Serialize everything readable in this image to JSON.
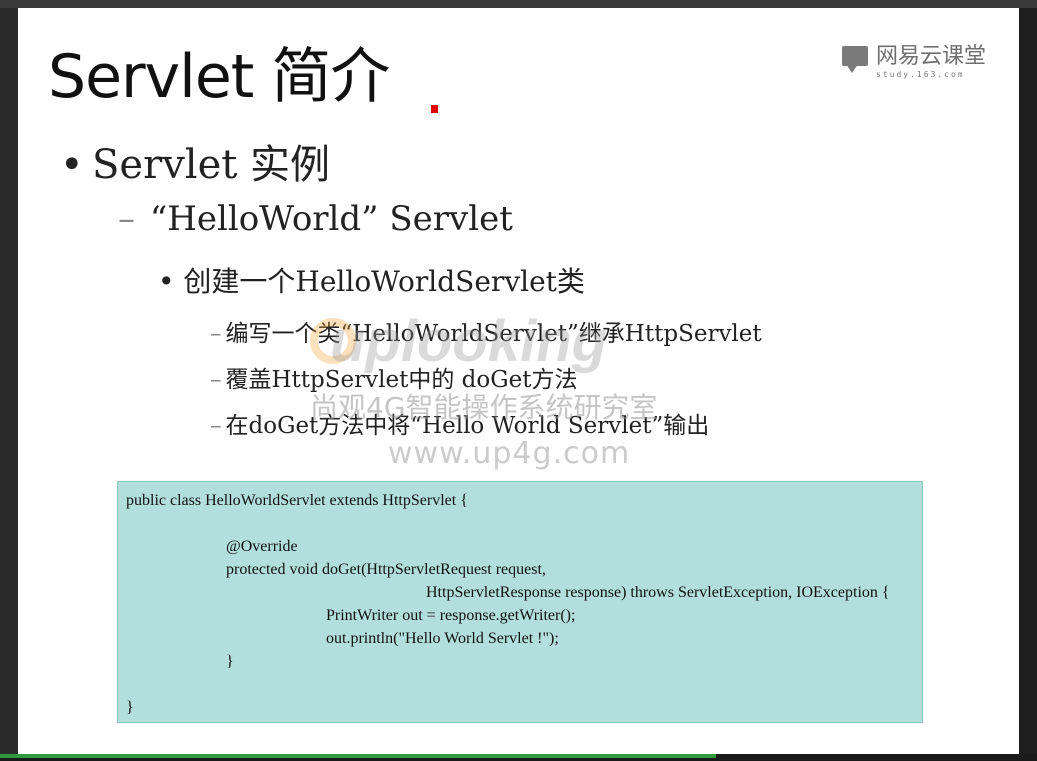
{
  "slide": {
    "title": "Servlet 简介",
    "logo": {
      "name": "网易云课堂",
      "url": "study.163.com"
    },
    "bullets": {
      "level1": "Servlet 实例",
      "level2": "“HelloWorld” Servlet",
      "level3": "创建一个HelloWorldServlet类",
      "level4": [
        "编写一个类“HelloWorldServlet”继承HttpServlet",
        "覆盖HttpServlet中的 doGet方法",
        "在doGet方法中将“Hello World Servlet”输出"
      ]
    },
    "watermark": {
      "brand": "uplooking",
      "chinese": "尚观4G智能操作系统研究室",
      "url": "www.up4g.com"
    },
    "code": [
      "public class HelloWorldServlet extends HttpServlet {",
      "",
      "@Override",
      "protected void doGet(HttpServletRequest request,",
      "HttpServletResponse response) throws ServletException, IOException {",
      "PrintWriter out = response.getWriter();",
      "out.println(\"Hello World Servlet !\");",
      "}",
      "",
      "}"
    ]
  },
  "player": {
    "progress_fraction": 0.69,
    "progress_color": "#2e9b3a"
  },
  "colors": {
    "code_background": "#b2dfdd",
    "marker": "#e00000"
  }
}
